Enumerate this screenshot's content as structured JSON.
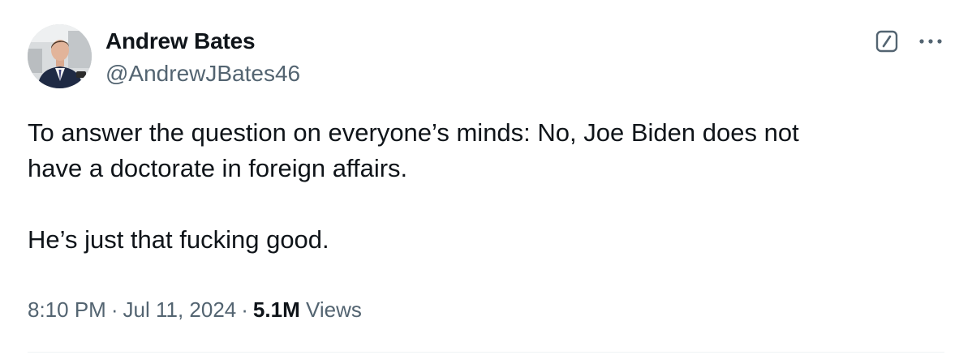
{
  "author": {
    "display_name": "Andrew Bates",
    "handle": "@AndrewJBates46"
  },
  "tweet": {
    "text": "To answer the question on everyone’s minds: No, Joe Biden does not\nhave a doctorate in foreign affairs.\n\nHe’s just that fucking good."
  },
  "meta": {
    "time": "8:10 PM",
    "separator": "·",
    "date": "Jul 11, 2024",
    "views_count": "5.1M",
    "views_label": "Views"
  },
  "icons": {
    "grok": "grok-icon",
    "more": "more-icon"
  },
  "colors": {
    "text_primary": "#0f1419",
    "text_secondary": "#536471",
    "divider": "#eff3f4"
  }
}
